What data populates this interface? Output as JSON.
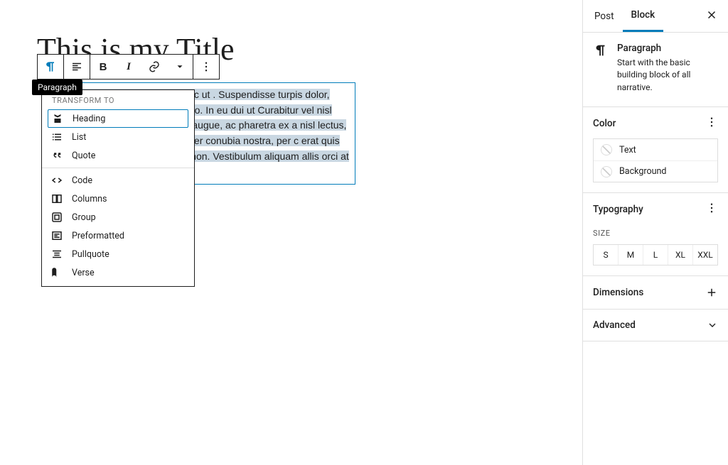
{
  "title": "This is my Title",
  "tooltip": "Paragraph",
  "transform": {
    "label": "Transform to",
    "primary": [
      {
        "icon": "heading",
        "label": "Heading"
      },
      {
        "icon": "list",
        "label": "List"
      },
      {
        "icon": "quote",
        "label": "Quote"
      }
    ],
    "secondary": [
      {
        "icon": "code",
        "label": "Code"
      },
      {
        "icon": "columns",
        "label": "Columns"
      },
      {
        "icon": "group",
        "label": "Group"
      },
      {
        "icon": "preformatted",
        "label": "Preformatted"
      },
      {
        "icon": "pullquote",
        "label": "Pullquote"
      },
      {
        "icon": "verse",
        "label": "Verse"
      }
    ]
  },
  "paragraph": "ur adipiscing elit. Mauris nec nunc ut . Suspendisse turpis dolor, maximus Mauris eu vulputate odio. In eu dui ut Curabitur vel nisl rhoncus, efficitur euismod libero augue, ac pharetra ex a nisl lectus, eu laoreet dui ornare at. rquent per conubia nostra, per c erat quis molestie. Quisque mollis empor non. Vestibulum aliquam allis orci at sodales sollicitudin.",
  "sidebar": {
    "tabs": {
      "post": "Post",
      "block": "Block"
    },
    "card": {
      "title": "Paragraph",
      "desc": "Start with the basic building block of all narrative."
    },
    "color": {
      "title": "Color",
      "rows": {
        "text": "Text",
        "background": "Background"
      }
    },
    "typography": {
      "title": "Typography",
      "size_label": "Size",
      "sizes": [
        "S",
        "M",
        "L",
        "XL",
        "XXL"
      ]
    },
    "dimensions": "Dimensions",
    "advanced": "Advanced"
  }
}
